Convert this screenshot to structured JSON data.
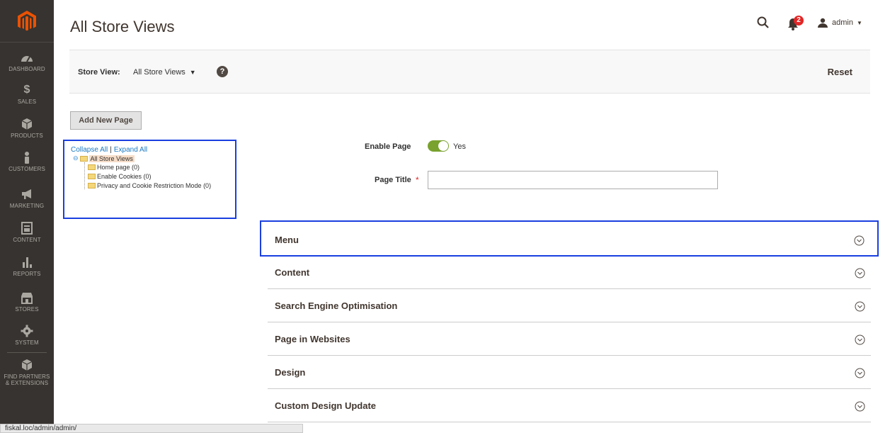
{
  "header": {
    "page_title": "All Store Views",
    "notification_count": "2",
    "user_name": "admin"
  },
  "sidebar": {
    "items": [
      {
        "label": "DASHBOARD",
        "icon": "dashboard-icon"
      },
      {
        "label": "SALES",
        "icon": "dollar-icon"
      },
      {
        "label": "PRODUCTS",
        "icon": "box-icon"
      },
      {
        "label": "CUSTOMERS",
        "icon": "person-icon"
      },
      {
        "label": "MARKETING",
        "icon": "megaphone-icon"
      },
      {
        "label": "CONTENT",
        "icon": "content-icon"
      },
      {
        "label": "REPORTS",
        "icon": "bar-chart-icon"
      },
      {
        "label": "STORES",
        "icon": "storefront-icon"
      },
      {
        "label": "SYSTEM",
        "icon": "gear-icon"
      },
      {
        "label_line1": "FIND PARTNERS",
        "label_line2": "& EXTENSIONS",
        "icon": "partners-box-icon"
      }
    ]
  },
  "store_bar": {
    "label": "Store View:",
    "selected": "All Store Views",
    "reset_label": "Reset"
  },
  "actions": {
    "add_page_label": "Add New Page"
  },
  "tree": {
    "collapse_label": "Collapse All",
    "separator": "|",
    "expand_label": "Expand All",
    "root": "All Store Views",
    "children": [
      "Home page (0)",
      "Enable Cookies (0)",
      "Privacy and Cookie Restriction Mode (0)"
    ]
  },
  "form": {
    "enable_label": "Enable Page",
    "enable_value": "Yes",
    "title_label": "Page Title",
    "title_required_mark": "*",
    "title_value": ""
  },
  "sections": [
    "Menu",
    "Content",
    "Search Engine Optimisation",
    "Page in Websites",
    "Design",
    "Custom Design Update"
  ],
  "status_bar": {
    "url": "fiskal.loc/admin/admin/"
  },
  "colors": {
    "sidebar_bg": "#373330",
    "accent_orange": "#eb5202",
    "toggle_on": "#79a22e",
    "highlight_border": "#1a3fe0"
  }
}
